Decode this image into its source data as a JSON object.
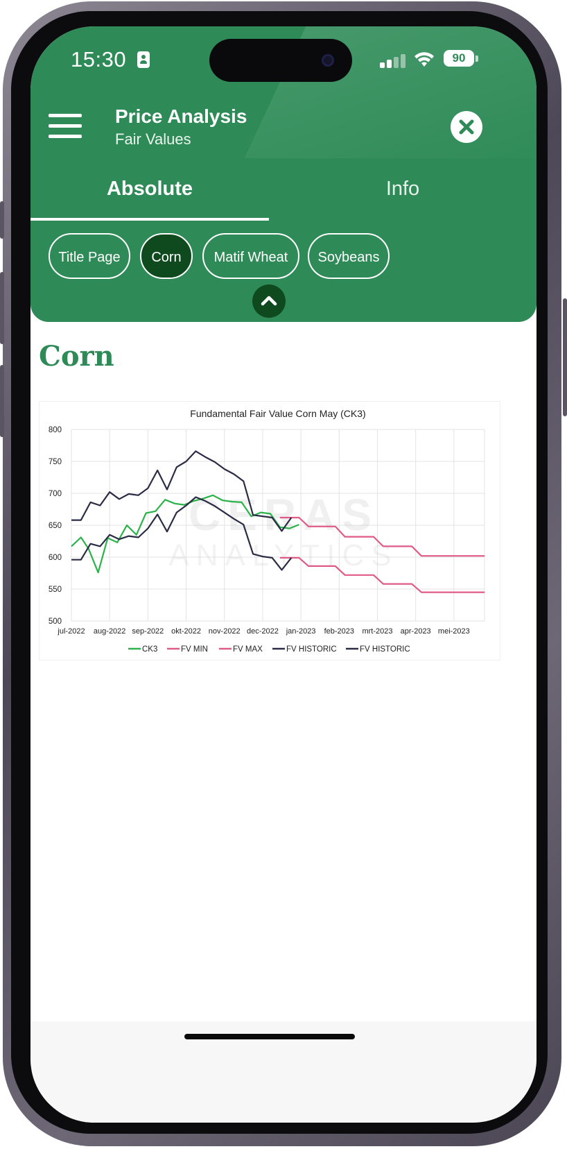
{
  "status_bar": {
    "time": "15:30",
    "battery": "90"
  },
  "header": {
    "title": "Price Analysis",
    "subtitle": "Fair Values",
    "tabs": [
      {
        "label": "Absolute",
        "active": true
      },
      {
        "label": "Info",
        "active": false
      }
    ],
    "chips": [
      {
        "label": "Title Page",
        "active": false
      },
      {
        "label": "Corn",
        "active": true
      },
      {
        "label": "Matif Wheat",
        "active": false
      },
      {
        "label": "Soybeans",
        "active": false
      }
    ]
  },
  "content": {
    "section_title": "Corn"
  },
  "colors": {
    "header_green": "#2e8b57",
    "active_chip": "#0f4a1f",
    "ck3": "#2bb34a",
    "fv": "#e05a86",
    "historic": "#2a2b45"
  },
  "chart_data": {
    "type": "line",
    "title": "Fundamental Fair Value Corn May (CK3)",
    "ylim": [
      500,
      800
    ],
    "yticks": [
      500,
      550,
      600,
      650,
      700,
      750,
      800
    ],
    "xlim": [
      0,
      10.8
    ],
    "categories": [
      "jul-2022",
      "aug-2022",
      "sep-2022",
      "okt-2022",
      "nov-2022",
      "dec-2022",
      "jan-2023",
      "feb-2023",
      "mrt-2023",
      "apr-2023",
      "mei-2023"
    ],
    "watermark": "CERAS ANALYTICS",
    "grid": true,
    "legend_position": "bottom",
    "series": [
      {
        "name": "CK3",
        "color": "#2bb34a",
        "points": [
          [
            0,
            617
          ],
          [
            0.25,
            631
          ],
          [
            0.45,
            613
          ],
          [
            0.7,
            576
          ],
          [
            0.95,
            630
          ],
          [
            1.2,
            623
          ],
          [
            1.45,
            650
          ],
          [
            1.7,
            635
          ],
          [
            1.95,
            669
          ],
          [
            2.2,
            672
          ],
          [
            2.45,
            690
          ],
          [
            2.7,
            684
          ],
          [
            2.95,
            682
          ],
          [
            3.2,
            688
          ],
          [
            3.45,
            692
          ],
          [
            3.7,
            697
          ],
          [
            3.95,
            689
          ],
          [
            4.2,
            687
          ],
          [
            4.45,
            686
          ],
          [
            4.7,
            664
          ],
          [
            4.95,
            670
          ],
          [
            5.2,
            668
          ],
          [
            5.45,
            647
          ],
          [
            5.7,
            645
          ],
          [
            5.95,
            651
          ]
        ]
      },
      {
        "name": "FV MIN",
        "color": "#e05a86",
        "points": [
          [
            5.45,
            599
          ],
          [
            5.95,
            599
          ],
          [
            6.2,
            586
          ],
          [
            6.9,
            586
          ],
          [
            7.15,
            572
          ],
          [
            7.9,
            572
          ],
          [
            8.15,
            558
          ],
          [
            8.9,
            558
          ],
          [
            9.15,
            545
          ],
          [
            10.8,
            545
          ]
        ]
      },
      {
        "name": "FV MAX",
        "color": "#e05a86",
        "points": [
          [
            5.45,
            662
          ],
          [
            5.95,
            662
          ],
          [
            6.2,
            648
          ],
          [
            6.9,
            648
          ],
          [
            7.15,
            632
          ],
          [
            7.9,
            632
          ],
          [
            8.15,
            617
          ],
          [
            8.9,
            617
          ],
          [
            9.15,
            602
          ],
          [
            10.8,
            602
          ]
        ]
      },
      {
        "name": "FV HISTORIC",
        "color": "#2a2b45",
        "points": [
          [
            0,
            658
          ],
          [
            0.25,
            658
          ],
          [
            0.5,
            686
          ],
          [
            0.75,
            681
          ],
          [
            1.0,
            702
          ],
          [
            1.25,
            691
          ],
          [
            1.5,
            699
          ],
          [
            1.75,
            697
          ],
          [
            2.0,
            708
          ],
          [
            2.25,
            736
          ],
          [
            2.5,
            706
          ],
          [
            2.75,
            741
          ],
          [
            3.0,
            750
          ],
          [
            3.25,
            766
          ],
          [
            3.5,
            757
          ],
          [
            3.75,
            749
          ],
          [
            4.0,
            738
          ],
          [
            4.25,
            730
          ],
          [
            4.5,
            719
          ],
          [
            4.75,
            666
          ],
          [
            5.0,
            664
          ],
          [
            5.25,
            662
          ],
          [
            5.5,
            641
          ],
          [
            5.75,
            662
          ]
        ]
      },
      {
        "name": "FV HISTORIC",
        "color": "#2a2b45",
        "points": [
          [
            0,
            596
          ],
          [
            0.25,
            596
          ],
          [
            0.5,
            621
          ],
          [
            0.75,
            617
          ],
          [
            1.0,
            635
          ],
          [
            1.25,
            628
          ],
          [
            1.5,
            633
          ],
          [
            1.75,
            631
          ],
          [
            2.0,
            645
          ],
          [
            2.25,
            667
          ],
          [
            2.5,
            640
          ],
          [
            2.75,
            670
          ],
          [
            3.0,
            681
          ],
          [
            3.25,
            694
          ],
          [
            3.5,
            688
          ],
          [
            3.75,
            680
          ],
          [
            4.0,
            670
          ],
          [
            4.25,
            660
          ],
          [
            4.5,
            651
          ],
          [
            4.75,
            605
          ],
          [
            5.0,
            601
          ],
          [
            5.25,
            599
          ],
          [
            5.5,
            580
          ],
          [
            5.75,
            599
          ]
        ]
      }
    ]
  }
}
